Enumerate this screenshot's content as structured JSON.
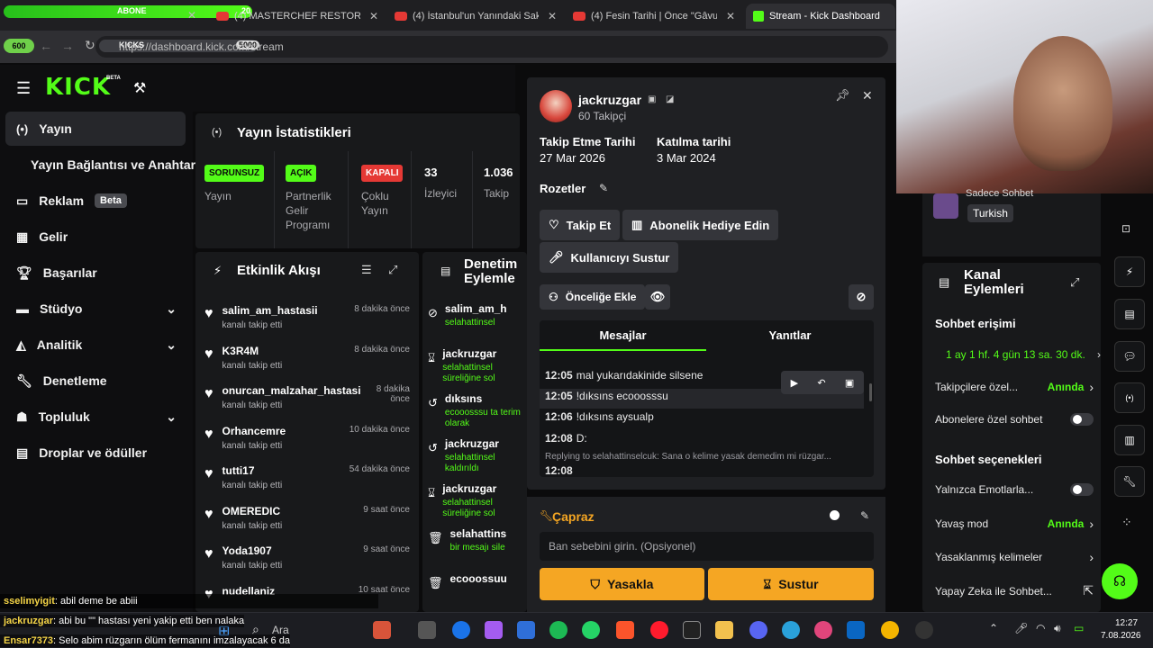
{
  "browser": {
    "tabs": [
      {
        "label": "ABONE",
        "progress_text": "20"
      },
      {
        "label": "(4) MASTERCHEF RESTORANLA"
      },
      {
        "label": "(4) İstanbul'un Yanındaki Saklı C"
      },
      {
        "label": "(4) Fesin Tarihi | Önce \"Gâvur Ba"
      },
      {
        "label": "Stream - Kick Dashboard"
      }
    ],
    "url": "https://dashboard.kick.com/stream",
    "overlay_left": "600",
    "overlay_mid": "KICKS",
    "overlay_right": "5000"
  },
  "nav": {
    "logo": "KICK",
    "logo_badge": "BETA",
    "items": [
      {
        "label": "Yayın"
      },
      {
        "label": "Yayın Bağlantısı ve Anahtarı"
      },
      {
        "label": "Reklam",
        "badge": "Beta"
      },
      {
        "label": "Gelir"
      },
      {
        "label": "Başarılar"
      },
      {
        "label": "Stüdyo"
      },
      {
        "label": "Analitik"
      },
      {
        "label": "Denetleme"
      },
      {
        "label": "Topluluk"
      },
      {
        "label": "Droplar ve ödüller"
      }
    ]
  },
  "stats": {
    "title": "Yayın İstatistikleri",
    "cells": [
      {
        "pill": "SORUNSUZ",
        "label": "Yayın"
      },
      {
        "pill": "AÇIK",
        "label": "Partnerlik Gelir Programı"
      },
      {
        "pill": "KAPALI",
        "label": "Çoklu Yayın"
      },
      {
        "value": "33",
        "label": "İzleyici"
      },
      {
        "value": "1.036",
        "label": "Takip"
      }
    ]
  },
  "feed": {
    "title": "Etkinlik Akışı",
    "rows": [
      {
        "name": "salim_am_hastasii",
        "sub": "kanalı takip etti",
        "time": "8 dakika önce"
      },
      {
        "name": "K3R4M",
        "sub": "kanalı takip etti",
        "time": "8 dakika önce"
      },
      {
        "name": "onurcan_malzahar_hastasi",
        "sub": "kanalı takip etti",
        "time": "8 dakika önce"
      },
      {
        "name": "Orhancemre",
        "sub": "kanalı takip etti",
        "time": "10 dakika önce"
      },
      {
        "name": "tutti17",
        "sub": "kanalı takip etti",
        "time": "54 dakika önce"
      },
      {
        "name": "OMEREDIC",
        "sub": "kanalı takip etti",
        "time": "9 saat önce"
      },
      {
        "name": "Yoda1907",
        "sub": "kanalı takip etti",
        "time": "9 saat önce"
      },
      {
        "name": "nudellaniz",
        "sub": "",
        "time": "10 saat önce"
      }
    ]
  },
  "moderation": {
    "title": "Denetim Eylemle",
    "rows": [
      {
        "name": "salim_am_h",
        "sub": "selahattinsel"
      },
      {
        "name": "jackruzgar",
        "sub": "selahattinsel süreliğine sol"
      },
      {
        "name": "dıksıns",
        "sub": "ecooosssu ta terim olarak"
      },
      {
        "name": "jackruzgar",
        "sub": "selahattinsel kaldırıldı"
      },
      {
        "name": "jackruzgar",
        "sub": "selahattinsel süreliğine sol"
      },
      {
        "name": "selahattins",
        "sub": "bir mesajı sile"
      },
      {
        "name": "ecooossuu",
        "sub": ""
      }
    ]
  },
  "card": {
    "username": "jackruzgar",
    "followers": "60 Takipçi",
    "follow_date_label": "Takip Etme Tarihi",
    "follow_date": "27 Mar 2026",
    "join_date_label": "Katılma tarihi",
    "join_date": "3 Mar 2024",
    "badges_label": "Rozetler",
    "follow_btn": "Takip Et",
    "gift_btn": "Abonelik Hediye Edin",
    "mute_btn": "Kullanıcıyı Sustur",
    "priority_btn": "Önceliğe Ekle",
    "tab_messages": "Mesajlar",
    "tab_replies": "Yanıtlar",
    "messages": [
      {
        "time": "12:05",
        "text": "mal yukarıdakinide silsene"
      },
      {
        "time": "12:05",
        "text": "!dıksıns ecooosssu"
      },
      {
        "time": "12:06",
        "text": "!dıksıns aysualp"
      },
      {
        "time": "12:08",
        "text": "D:"
      },
      {
        "time": "",
        "text": "Replying to selahattinselcuk: Sana o kelime yasak demedim mi rüzgar..."
      },
      {
        "time": "12:08",
        "text": ""
      }
    ]
  },
  "ban": {
    "title": "Çapraz",
    "placeholder": "Ban sebebini girin. (Opsiyonel)",
    "ban_btn": "Yasakla",
    "mute_btn": "Sustur"
  },
  "chat_overlay": [
    {
      "user": "sselimyigit",
      "text": ": abil deme be abiii"
    },
    {
      "user": "jackruzgar",
      "text": ": abi bu \"\" hastası yeni yakip etti ben nalaka"
    },
    {
      "user": "Ensar7373",
      "text": ": Selo abim rüzgarın ölüm fermanını imzalayacak 6 da"
    }
  ],
  "right": {
    "chat_mode": "Sadece Sohbet",
    "language": "Turkish",
    "title": "Kanal Eylemleri",
    "access_heading": "Sohbet erişimi",
    "access_value": "1 ay 1 hf. 4 gün 13 sa. 30 dk.",
    "rows1": [
      {
        "label": "Takipçilere özel...",
        "value": "Anında",
        "type": "chevron"
      },
      {
        "label": "Abonelere özel sohbet",
        "value": "",
        "type": "toggle"
      }
    ],
    "options_heading": "Sohbet seçenekleri",
    "rows2": [
      {
        "label": "Yalnızca Emotlarla...",
        "value": "",
        "type": "toggle"
      },
      {
        "label": "Yavaş mod",
        "value": "Anında",
        "type": "chevron"
      },
      {
        "label": "Yasaklanmış kelimeler",
        "value": "",
        "type": "chevron"
      },
      {
        "label": "Yapay Zeka ile Sohbet...",
        "value": "",
        "type": "external"
      }
    ]
  },
  "taskbar": {
    "search": "Ara",
    "time": "12:27",
    "date": "7.08.2026"
  },
  "colors": {
    "kick_green": "#53fc18",
    "accent_orange": "#f5a623",
    "danger_red": "#e53935"
  }
}
